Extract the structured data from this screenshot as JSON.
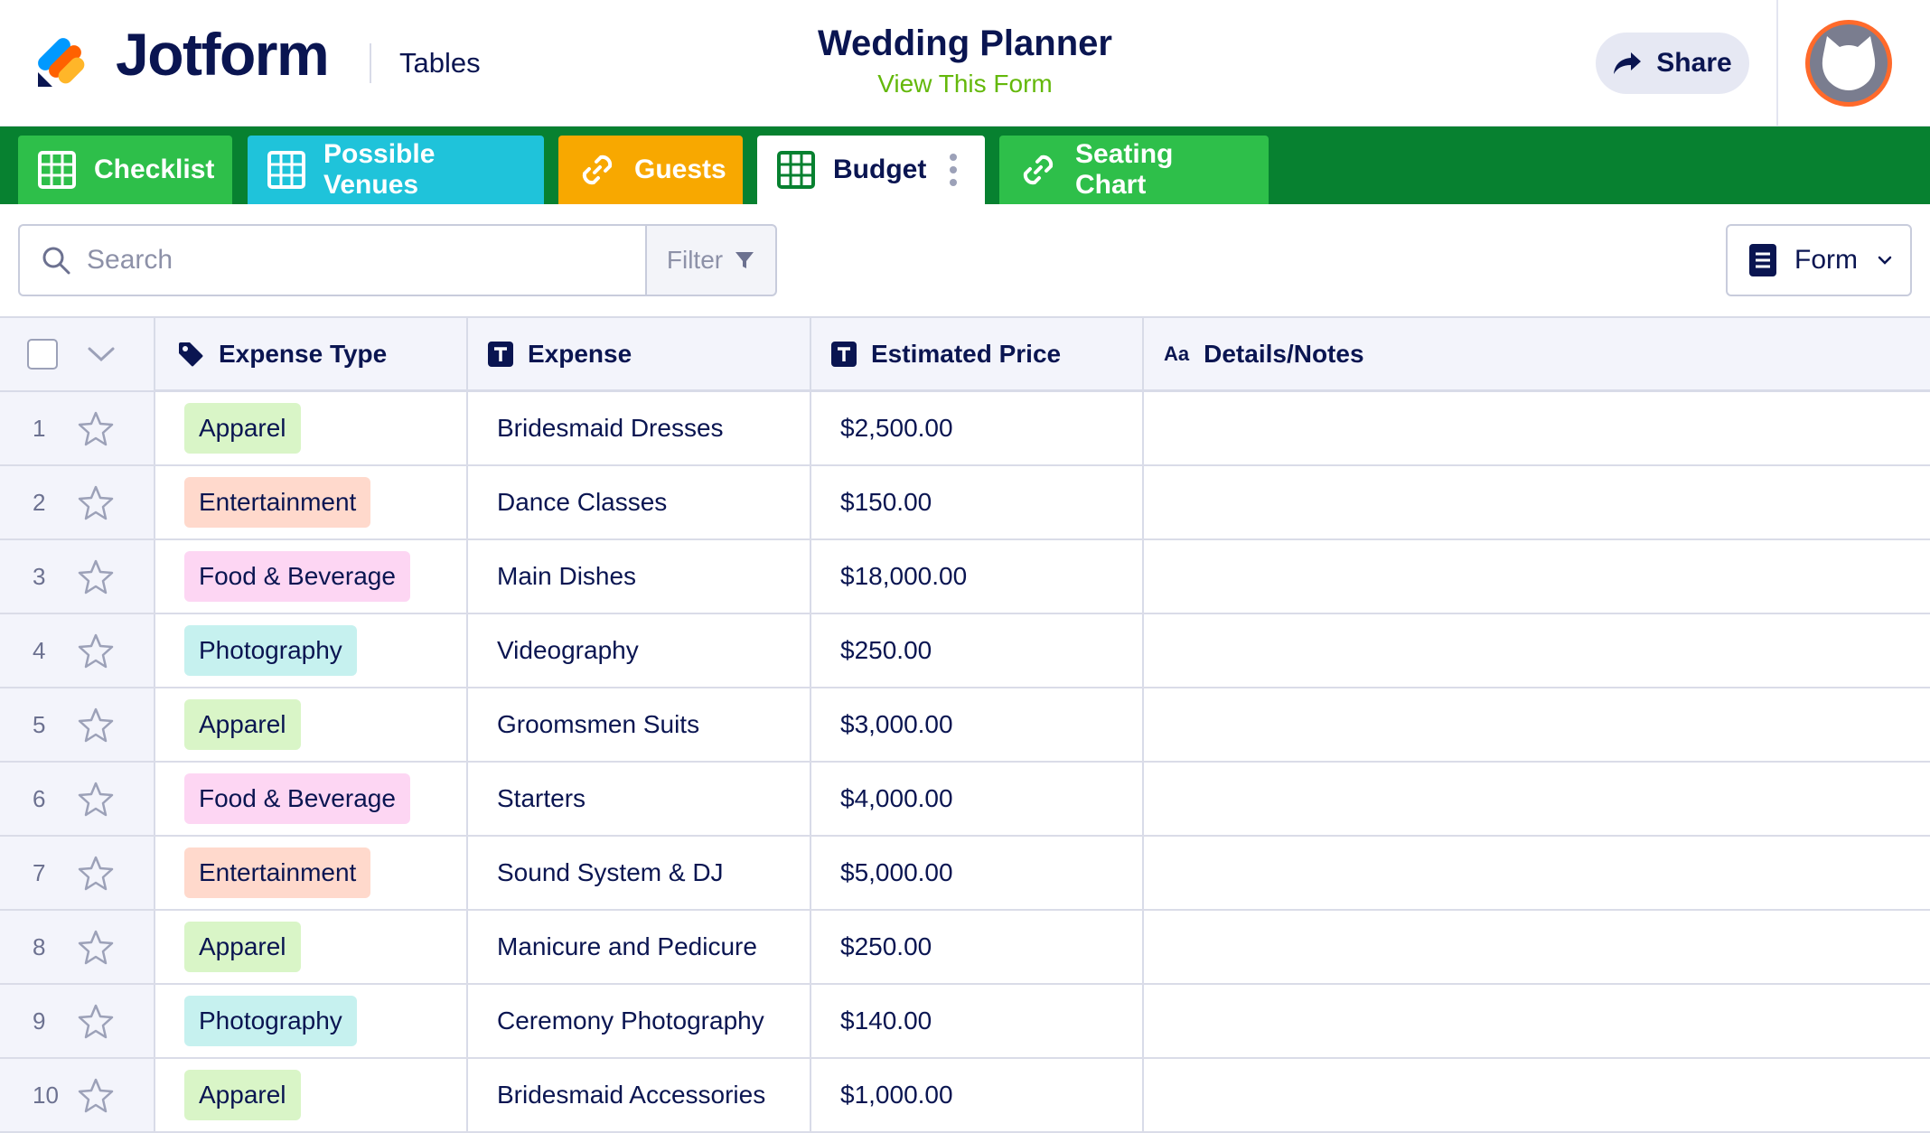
{
  "header": {
    "brand": "Jotform",
    "app_name": "Tables",
    "title": "Wedding Planner",
    "view_form_link": "View This Form",
    "share_label": "Share"
  },
  "tabs": [
    {
      "label": "Checklist",
      "icon": "table-grid-icon",
      "color": "#2ebf4a"
    },
    {
      "label": "Possible Venues",
      "icon": "table-grid-icon",
      "color": "#1fc3da"
    },
    {
      "label": "Guests",
      "icon": "link-icon",
      "color": "#f8a800"
    },
    {
      "label": "Budget",
      "icon": "table-grid-icon",
      "color": "#ffffff",
      "active": true
    },
    {
      "label": "Seating Chart",
      "icon": "link-icon",
      "color": "#2ebf4a"
    }
  ],
  "toolbar": {
    "search_placeholder": "Search",
    "filter_label": "Filter",
    "form_label": "Form"
  },
  "table": {
    "columns": [
      {
        "label": "Expense Type",
        "icon": "tag-icon"
      },
      {
        "label": "Expense",
        "icon": "text-type-icon"
      },
      {
        "label": "Estimated Price",
        "icon": "text-type-icon"
      },
      {
        "label": "Details/Notes",
        "icon": "long-text-icon",
        "icon_text": "Aa"
      }
    ],
    "rows": [
      {
        "n": "1",
        "type": "Apparel",
        "expense": "Bridesmaid Dresses",
        "price": "$2,500.00",
        "notes": ""
      },
      {
        "n": "2",
        "type": "Entertainment",
        "expense": "Dance Classes",
        "price": "$150.00",
        "notes": ""
      },
      {
        "n": "3",
        "type": "Food & Beverage",
        "expense": "Main Dishes",
        "price": "$18,000.00",
        "notes": ""
      },
      {
        "n": "4",
        "type": "Photography",
        "expense": "Videography",
        "price": "$250.00",
        "notes": ""
      },
      {
        "n": "5",
        "type": "Apparel",
        "expense": "Groomsmen Suits",
        "price": "$3,000.00",
        "notes": ""
      },
      {
        "n": "6",
        "type": "Food & Beverage",
        "expense": "Starters",
        "price": "$4,000.00",
        "notes": ""
      },
      {
        "n": "7",
        "type": "Entertainment",
        "expense": "Sound System & DJ",
        "price": "$5,000.00",
        "notes": ""
      },
      {
        "n": "8",
        "type": "Apparel",
        "expense": "Manicure and Pedicure",
        "price": "$250.00",
        "notes": ""
      },
      {
        "n": "9",
        "type": "Photography",
        "expense": "Ceremony Photography",
        "price": "$140.00",
        "notes": ""
      },
      {
        "n": "10",
        "type": "Apparel",
        "expense": "Bridesmaid Accessories",
        "price": "$1,000.00",
        "notes": ""
      }
    ],
    "tag_colors": {
      "Apparel": "#d9f5c7",
      "Entertainment": "#ffd9cc",
      "Food & Beverage": "#fdd6f3",
      "Photography": "#c6f1ef"
    }
  },
  "colors": {
    "tabbar": "#078130",
    "brand_navy": "#0a1551",
    "link_green": "#64b80b",
    "avatar_ring": "#ff6a2b"
  }
}
